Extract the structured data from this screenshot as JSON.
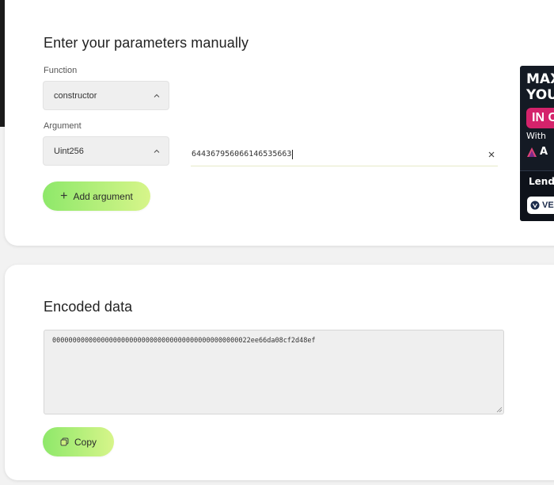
{
  "params": {
    "title": "Enter your parameters manually",
    "function_label": "Function",
    "function_value": "constructor",
    "argument_label": "Argument",
    "argument_type": "Uint256",
    "argument_value": "644367956066146535663",
    "add_argument_label": "Add argument"
  },
  "encoded": {
    "title": "Encoded data",
    "value": "0000000000000000000000000000000000000000000000022ee66da08cf2d48ef",
    "copy_label": "Copy"
  },
  "ad": {
    "line1": "MAX",
    "line2": "YOU",
    "pill": "IN C",
    "with": "With",
    "brand": "A",
    "lending": "Lendi",
    "badge": "VE"
  },
  "colors": {
    "accent_start": "#8ee86a",
    "accent_end": "#d7f58a",
    "ad_pink": "#d4236b",
    "ad_dark": "#141a24"
  }
}
